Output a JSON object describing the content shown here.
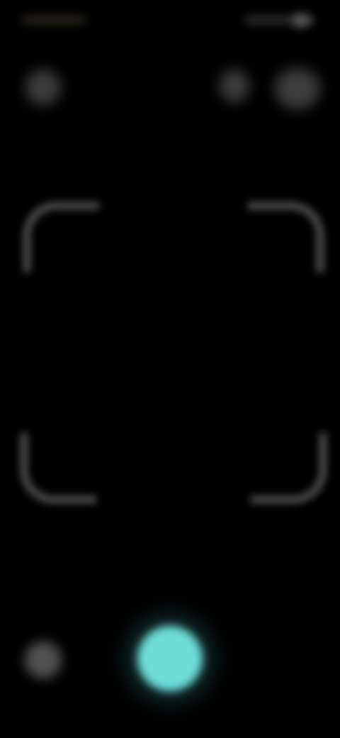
{
  "status_bar": {
    "time": "",
    "indicators": ""
  },
  "top_controls": {
    "left_icon": "flash-icon",
    "mid_icon": "settings-icon",
    "right_icon": "switch-camera-icon"
  },
  "scanner": {
    "frame": "scan-frame"
  },
  "bottom_controls": {
    "gallery_icon": "gallery-icon",
    "shutter_icon": "shutter-icon"
  },
  "colors": {
    "background": "#000000",
    "shutter": "#6fdcd8",
    "frame": "#7d7d7d"
  }
}
